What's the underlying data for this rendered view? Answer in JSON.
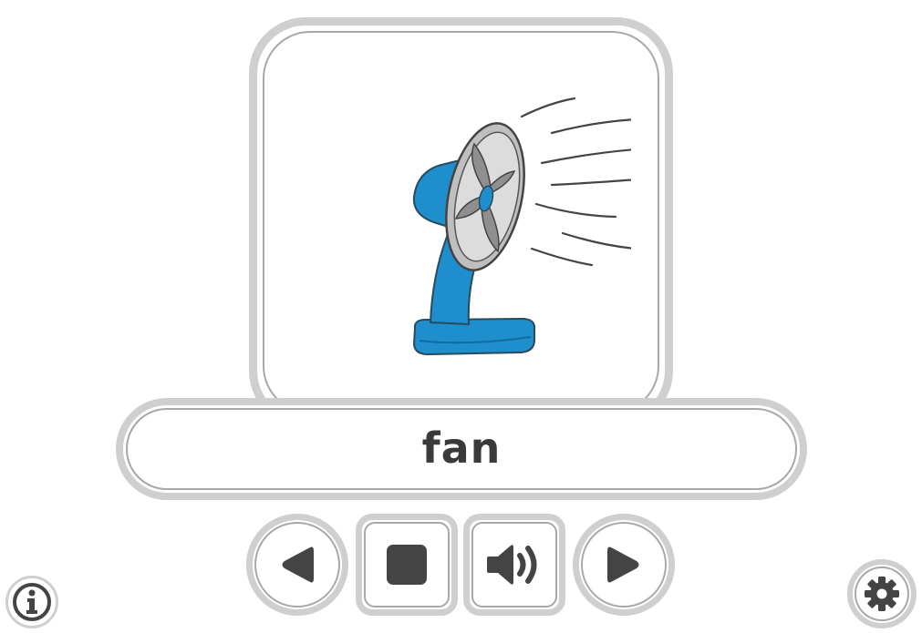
{
  "card": {
    "word": "fan",
    "image_icon": "desk-fan-icon"
  },
  "controls": {
    "previous": {
      "icon": "triangle-left-icon"
    },
    "stop": {
      "icon": "stop-square-icon"
    },
    "play_audio": {
      "icon": "speaker-icon"
    },
    "next": {
      "icon": "triangle-right-icon"
    }
  },
  "corner": {
    "info": {
      "icon": "info-icon"
    },
    "settings": {
      "icon": "gear-icon"
    }
  },
  "colors": {
    "fan_blue": "#1e8fcc",
    "fan_blue_dark": "#136a9c",
    "button_border": "#cfcfcf",
    "icon_dark": "#444444",
    "text": "#3a3a3a"
  }
}
